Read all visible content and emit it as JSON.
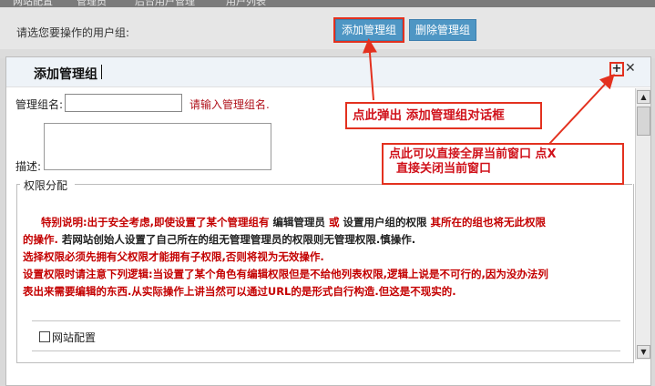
{
  "breadcrumb": [
    "网站配置",
    "管理员",
    "后台用户管理",
    "用户列表"
  ],
  "toolbar": {
    "prompt": "请选您要操作的用户组:",
    "add_button": "添加管理组",
    "delete_button": "删除管理组"
  },
  "dialog": {
    "title": "添加管理组",
    "max_icon": "+",
    "close_icon": "✕",
    "name_label": "管理组名:",
    "name_hint": "请输入管理组名.",
    "desc_label": "描述:",
    "fieldset_legend": "权限分配",
    "notice": {
      "line1_red": "特别说明:出于安全考虑,即使设置了某个管理组有",
      "line1_dark": "编辑管理员",
      "line1_or": "或",
      "line1_dark2": "设置用户组的权限",
      "line1_red2": "其所在的组也将无此权限",
      "line2_red": "的操作.",
      "line2_dark": "若网站创始人设置了自己所在的组无管理管理员的权限则无管理权限.慎操作.",
      "line3": "选择权限必须先拥有父权限才能拥有子权限,否则将视为无效操作.",
      "line4": "设置权限时请注意下列逻辑:当设置了某个角色有编辑权限但是不给他列表权限,逻辑上说是不可行的,因为没办法列",
      "line5": "表出来需要编辑的东西.从实际操作上讲当然可以通过URL的是形式自行构造.但这是不现实的."
    },
    "checkbox_label": "网站配置"
  },
  "annotations": {
    "callout1": "点此弹出 添加管理组对话框",
    "callout2_line1": "点此可以直接全屏当前窗口  点X",
    "callout2_line2": "直接关闭当前窗口"
  },
  "colors": {
    "accent_button": "#4e96c4",
    "annotation_red": "#e3311f",
    "notice_red": "#c40000"
  }
}
